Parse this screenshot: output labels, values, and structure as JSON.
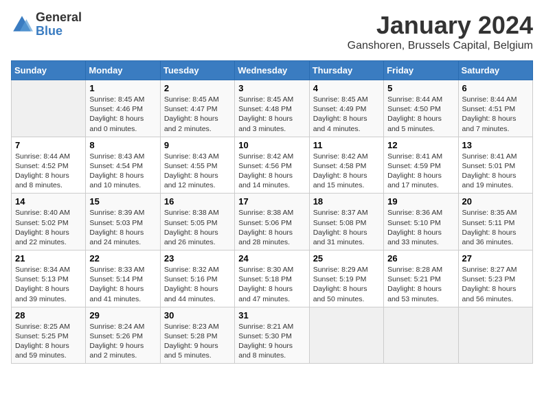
{
  "logo": {
    "general": "General",
    "blue": "Blue"
  },
  "title": "January 2024",
  "location": "Ganshoren, Brussels Capital, Belgium",
  "days_of_week": [
    "Sunday",
    "Monday",
    "Tuesday",
    "Wednesday",
    "Thursday",
    "Friday",
    "Saturday"
  ],
  "weeks": [
    [
      {
        "num": "",
        "sunrise": "",
        "sunset": "",
        "daylight": ""
      },
      {
        "num": "1",
        "sunrise": "Sunrise: 8:45 AM",
        "sunset": "Sunset: 4:46 PM",
        "daylight": "Daylight: 8 hours and 0 minutes."
      },
      {
        "num": "2",
        "sunrise": "Sunrise: 8:45 AM",
        "sunset": "Sunset: 4:47 PM",
        "daylight": "Daylight: 8 hours and 2 minutes."
      },
      {
        "num": "3",
        "sunrise": "Sunrise: 8:45 AM",
        "sunset": "Sunset: 4:48 PM",
        "daylight": "Daylight: 8 hours and 3 minutes."
      },
      {
        "num": "4",
        "sunrise": "Sunrise: 8:45 AM",
        "sunset": "Sunset: 4:49 PM",
        "daylight": "Daylight: 8 hours and 4 minutes."
      },
      {
        "num": "5",
        "sunrise": "Sunrise: 8:44 AM",
        "sunset": "Sunset: 4:50 PM",
        "daylight": "Daylight: 8 hours and 5 minutes."
      },
      {
        "num": "6",
        "sunrise": "Sunrise: 8:44 AM",
        "sunset": "Sunset: 4:51 PM",
        "daylight": "Daylight: 8 hours and 7 minutes."
      }
    ],
    [
      {
        "num": "7",
        "sunrise": "Sunrise: 8:44 AM",
        "sunset": "Sunset: 4:52 PM",
        "daylight": "Daylight: 8 hours and 8 minutes."
      },
      {
        "num": "8",
        "sunrise": "Sunrise: 8:43 AM",
        "sunset": "Sunset: 4:54 PM",
        "daylight": "Daylight: 8 hours and 10 minutes."
      },
      {
        "num": "9",
        "sunrise": "Sunrise: 8:43 AM",
        "sunset": "Sunset: 4:55 PM",
        "daylight": "Daylight: 8 hours and 12 minutes."
      },
      {
        "num": "10",
        "sunrise": "Sunrise: 8:42 AM",
        "sunset": "Sunset: 4:56 PM",
        "daylight": "Daylight: 8 hours and 14 minutes."
      },
      {
        "num": "11",
        "sunrise": "Sunrise: 8:42 AM",
        "sunset": "Sunset: 4:58 PM",
        "daylight": "Daylight: 8 hours and 15 minutes."
      },
      {
        "num": "12",
        "sunrise": "Sunrise: 8:41 AM",
        "sunset": "Sunset: 4:59 PM",
        "daylight": "Daylight: 8 hours and 17 minutes."
      },
      {
        "num": "13",
        "sunrise": "Sunrise: 8:41 AM",
        "sunset": "Sunset: 5:01 PM",
        "daylight": "Daylight: 8 hours and 19 minutes."
      }
    ],
    [
      {
        "num": "14",
        "sunrise": "Sunrise: 8:40 AM",
        "sunset": "Sunset: 5:02 PM",
        "daylight": "Daylight: 8 hours and 22 minutes."
      },
      {
        "num": "15",
        "sunrise": "Sunrise: 8:39 AM",
        "sunset": "Sunset: 5:03 PM",
        "daylight": "Daylight: 8 hours and 24 minutes."
      },
      {
        "num": "16",
        "sunrise": "Sunrise: 8:38 AM",
        "sunset": "Sunset: 5:05 PM",
        "daylight": "Daylight: 8 hours and 26 minutes."
      },
      {
        "num": "17",
        "sunrise": "Sunrise: 8:38 AM",
        "sunset": "Sunset: 5:06 PM",
        "daylight": "Daylight: 8 hours and 28 minutes."
      },
      {
        "num": "18",
        "sunrise": "Sunrise: 8:37 AM",
        "sunset": "Sunset: 5:08 PM",
        "daylight": "Daylight: 8 hours and 31 minutes."
      },
      {
        "num": "19",
        "sunrise": "Sunrise: 8:36 AM",
        "sunset": "Sunset: 5:10 PM",
        "daylight": "Daylight: 8 hours and 33 minutes."
      },
      {
        "num": "20",
        "sunrise": "Sunrise: 8:35 AM",
        "sunset": "Sunset: 5:11 PM",
        "daylight": "Daylight: 8 hours and 36 minutes."
      }
    ],
    [
      {
        "num": "21",
        "sunrise": "Sunrise: 8:34 AM",
        "sunset": "Sunset: 5:13 PM",
        "daylight": "Daylight: 8 hours and 39 minutes."
      },
      {
        "num": "22",
        "sunrise": "Sunrise: 8:33 AM",
        "sunset": "Sunset: 5:14 PM",
        "daylight": "Daylight: 8 hours and 41 minutes."
      },
      {
        "num": "23",
        "sunrise": "Sunrise: 8:32 AM",
        "sunset": "Sunset: 5:16 PM",
        "daylight": "Daylight: 8 hours and 44 minutes."
      },
      {
        "num": "24",
        "sunrise": "Sunrise: 8:30 AM",
        "sunset": "Sunset: 5:18 PM",
        "daylight": "Daylight: 8 hours and 47 minutes."
      },
      {
        "num": "25",
        "sunrise": "Sunrise: 8:29 AM",
        "sunset": "Sunset: 5:19 PM",
        "daylight": "Daylight: 8 hours and 50 minutes."
      },
      {
        "num": "26",
        "sunrise": "Sunrise: 8:28 AM",
        "sunset": "Sunset: 5:21 PM",
        "daylight": "Daylight: 8 hours and 53 minutes."
      },
      {
        "num": "27",
        "sunrise": "Sunrise: 8:27 AM",
        "sunset": "Sunset: 5:23 PM",
        "daylight": "Daylight: 8 hours and 56 minutes."
      }
    ],
    [
      {
        "num": "28",
        "sunrise": "Sunrise: 8:25 AM",
        "sunset": "Sunset: 5:25 PM",
        "daylight": "Daylight: 8 hours and 59 minutes."
      },
      {
        "num": "29",
        "sunrise": "Sunrise: 8:24 AM",
        "sunset": "Sunset: 5:26 PM",
        "daylight": "Daylight: 9 hours and 2 minutes."
      },
      {
        "num": "30",
        "sunrise": "Sunrise: 8:23 AM",
        "sunset": "Sunset: 5:28 PM",
        "daylight": "Daylight: 9 hours and 5 minutes."
      },
      {
        "num": "31",
        "sunrise": "Sunrise: 8:21 AM",
        "sunset": "Sunset: 5:30 PM",
        "daylight": "Daylight: 9 hours and 8 minutes."
      },
      {
        "num": "",
        "sunrise": "",
        "sunset": "",
        "daylight": ""
      },
      {
        "num": "",
        "sunrise": "",
        "sunset": "",
        "daylight": ""
      },
      {
        "num": "",
        "sunrise": "",
        "sunset": "",
        "daylight": ""
      }
    ]
  ]
}
